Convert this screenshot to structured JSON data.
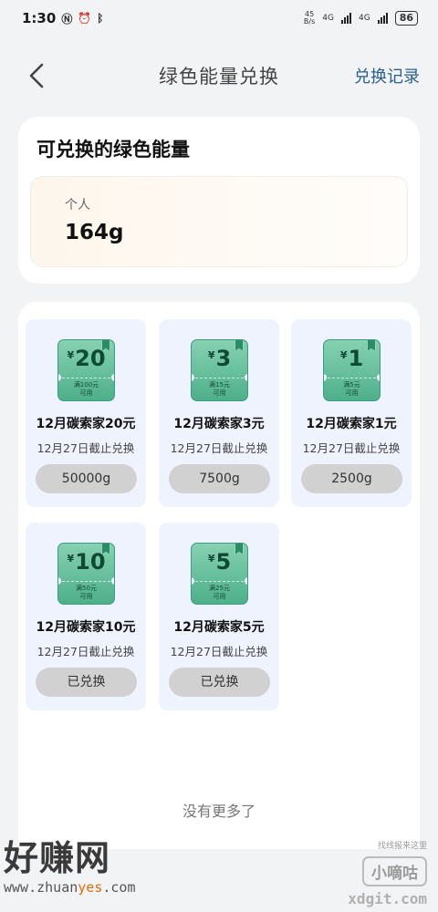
{
  "status_bar": {
    "time": "1:30",
    "net_speed_top": "45",
    "net_speed_bottom": "B/s",
    "sig1": "4G",
    "sig2": "4G",
    "battery": "86"
  },
  "nav": {
    "title": "绿色能量兑换",
    "record_label": "兑换记录"
  },
  "energy": {
    "title": "可兑换的绿色能量",
    "label": "个人",
    "value": "164g"
  },
  "coupons": [
    {
      "amount": "20",
      "currency": "¥",
      "cond1": "满100元",
      "cond2": "可用",
      "name": "12月碳索家20元",
      "deadline": "12月27日截止兑换",
      "button": "50000g"
    },
    {
      "amount": "3",
      "currency": "¥",
      "cond1": "满15元",
      "cond2": "可用",
      "name": "12月碳索家3元",
      "deadline": "12月27日截止兑换",
      "button": "7500g"
    },
    {
      "amount": "1",
      "currency": "¥",
      "cond1": "满5元",
      "cond2": "可用",
      "name": "12月碳索家1元",
      "deadline": "12月27日截止兑换",
      "button": "2500g"
    },
    {
      "amount": "10",
      "currency": "¥",
      "cond1": "满50元",
      "cond2": "可用",
      "name": "12月碳索家10元",
      "deadline": "12月27日截止兑换",
      "button": "已兑换"
    },
    {
      "amount": "5",
      "currency": "¥",
      "cond1": "满25元",
      "cond2": "可用",
      "name": "12月碳索家5元",
      "deadline": "12月27日截止兑换",
      "button": "已兑换"
    }
  ],
  "footer": {
    "no_more": "没有更多了"
  },
  "watermark": {
    "logo": "好赚网",
    "url_a": "www.zhuan",
    "url_b": "yes",
    "url_c": ".com",
    "small": "找线报来这里",
    "badge": "小嘀咕",
    "domain": "xdgit.com"
  }
}
